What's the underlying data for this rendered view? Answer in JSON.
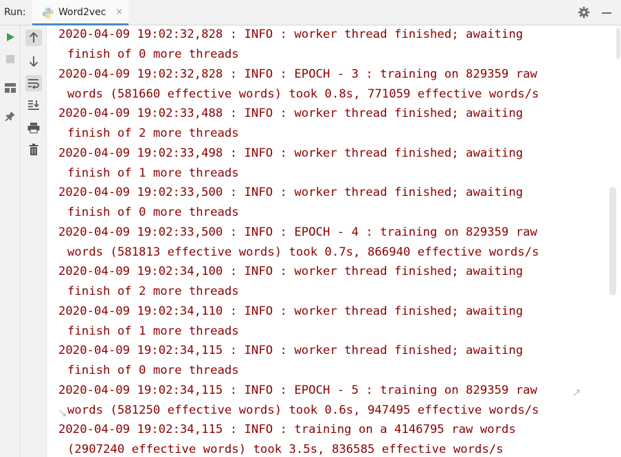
{
  "header": {
    "run_label": "Run:",
    "tab_title": "Word2vec",
    "tab_close": "×"
  },
  "toolbar": {
    "left_icons": [
      "play-icon",
      "stop-icon",
      "layout-icon",
      "pin-icon"
    ],
    "tool_icons": [
      "arrow-up-icon",
      "arrow-down-icon",
      "soft-wrap-icon",
      "scroll-to-end-icon",
      "print-icon",
      "trash-icon"
    ]
  },
  "console": {
    "lines": [
      "2020-04-09 19:02:32,828 : INFO : worker thread finished; awaiting",
      "finish of 0 more threads",
      "2020-04-09 19:02:32,828 : INFO : EPOCH - 3 : training on 829359 raw",
      "words (581660 effective words) took 0.8s, 771059 effective words/s",
      "2020-04-09 19:02:33,488 : INFO : worker thread finished; awaiting",
      "finish of 2 more threads",
      "2020-04-09 19:02:33,498 : INFO : worker thread finished; awaiting",
      "finish of 1 more threads",
      "2020-04-09 19:02:33,500 : INFO : worker thread finished; awaiting",
      "finish of 0 more threads",
      "2020-04-09 19:02:33,500 : INFO : EPOCH - 4 : training on 829359 raw",
      "words (581813 effective words) took 0.7s, 866940 effective words/s",
      "2020-04-09 19:02:34,100 : INFO : worker thread finished; awaiting",
      "finish of 2 more threads",
      "2020-04-09 19:02:34,110 : INFO : worker thread finished; awaiting",
      "finish of 1 more threads",
      "2020-04-09 19:02:34,115 : INFO : worker thread finished; awaiting",
      "finish of 0 more threads",
      "2020-04-09 19:02:34,115 : INFO : EPOCH - 5 : training on 829359 raw",
      "words (581250 effective words) took 0.6s, 947495 effective words/s",
      "2020-04-09 19:02:34,115 : INFO : training on a 4146795 raw words",
      "(2907240 effective words) took 3.5s, 836585 effective words/s"
    ]
  },
  "colors": {
    "log_text": "#8b0000",
    "accent": "#4a88c7",
    "run_green": "#3ea04b"
  }
}
